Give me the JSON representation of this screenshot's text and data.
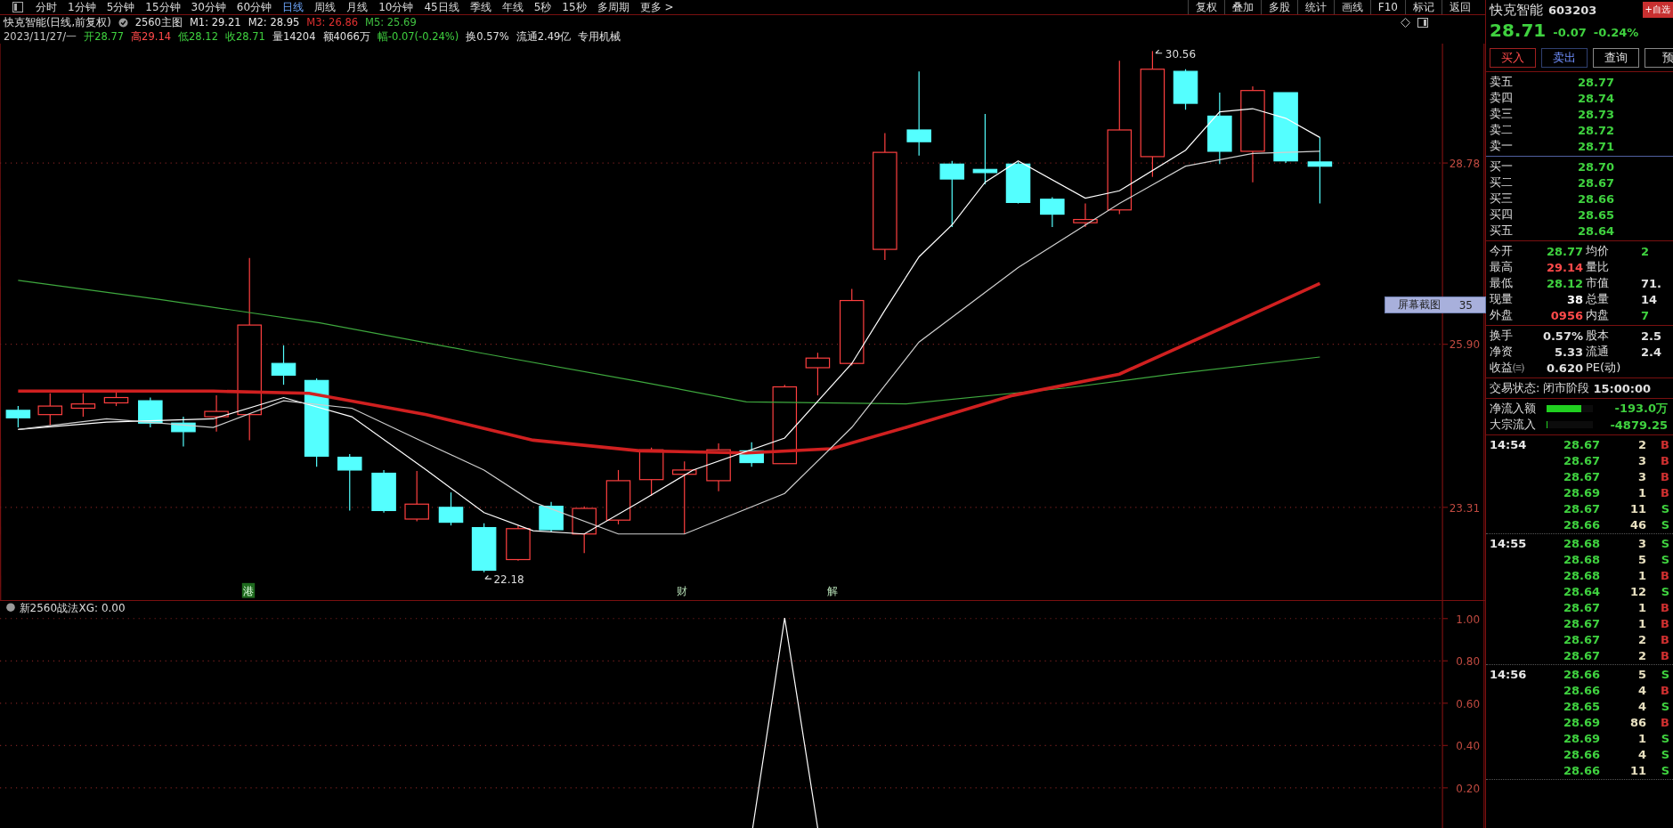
{
  "toolbar": {
    "periods": [
      {
        "label": "分时",
        "selected": false
      },
      {
        "label": "1分钟",
        "selected": false
      },
      {
        "label": "5分钟",
        "selected": false
      },
      {
        "label": "15分钟",
        "selected": false
      },
      {
        "label": "30分钟",
        "selected": false
      },
      {
        "label": "60分钟",
        "selected": false
      },
      {
        "label": "日线",
        "selected": true
      },
      {
        "label": "周线",
        "selected": false
      },
      {
        "label": "月线",
        "selected": false
      },
      {
        "label": "10分钟",
        "selected": false
      },
      {
        "label": "45日线",
        "selected": false
      },
      {
        "label": "季线",
        "selected": false
      },
      {
        "label": "年线",
        "selected": false
      },
      {
        "label": "5秒",
        "selected": false
      },
      {
        "label": "15秒",
        "selected": false
      },
      {
        "label": "多周期",
        "selected": false
      },
      {
        "label": "更多 >",
        "selected": false
      }
    ],
    "actions": [
      "复权",
      "叠加",
      "多股",
      "统计",
      "画线",
      "F10",
      "标记",
      "返回"
    ]
  },
  "chart_header": {
    "title": "快克智能(日线,前复权)",
    "template": "2560主图",
    "averages": [
      {
        "text": "M1: 29.21",
        "color": "#e8e8e8"
      },
      {
        "text": "M2: 28.95",
        "color": "#e8e8e8"
      },
      {
        "text": "M3: 26.86",
        "color": "#e03030"
      },
      {
        "text": "M5: 25.69",
        "color": "#40c040"
      }
    ],
    "quote": [
      {
        "text": "2023/11/27/一",
        "color": "#c8c8c8"
      },
      {
        "text": "开28.77",
        "color": "#3fd13f"
      },
      {
        "text": "高29.14",
        "color": "#ff4a4a"
      },
      {
        "text": "低28.12",
        "color": "#3fd13f"
      },
      {
        "text": "收28.71",
        "color": "#3fd13f"
      },
      {
        "text": "量14204",
        "color": "#e0e0e0"
      },
      {
        "text": "额4066万",
        "color": "#e0e0e0"
      },
      {
        "text": "幅-0.07(-0.24%)",
        "color": "#3fd13f"
      },
      {
        "text": "换0.57%",
        "color": "#e0e0e0"
      },
      {
        "text": "流通2.49亿",
        "color": "#e0e0e0"
      },
      {
        "text": "专用机械",
        "color": "#e0e0e0"
      }
    ]
  },
  "price_chart": {
    "price_axis": [
      "28.78",
      "25.90",
      "23.31"
    ],
    "high_label": "30.56",
    "low_label": "22.18",
    "events": [
      {
        "label": "港",
        "kind": "boxed"
      },
      {
        "label": "财",
        "kind": "plain"
      },
      {
        "label": "解",
        "kind": "plain"
      }
    ]
  },
  "indicator": {
    "name": "新2560战法",
    "reading": "XG: 0.00",
    "axis": [
      "1.00",
      "0.80",
      "0.60",
      "0.40",
      "0.20"
    ]
  },
  "quote_panel": {
    "name": "快克智能",
    "code": "603203",
    "watch_button": "+自选",
    "price": "28.71",
    "change": "-0.07",
    "change_pct": "-0.24%",
    "buttons": [
      {
        "label": "买入",
        "kind": "buy"
      },
      {
        "label": "卖出",
        "kind": "sell"
      },
      {
        "label": "查询",
        "kind": "plain"
      },
      {
        "label": "预",
        "kind": "plain"
      }
    ],
    "asks": [
      {
        "label": "卖五",
        "price": "28.77"
      },
      {
        "label": "卖四",
        "price": "28.74"
      },
      {
        "label": "卖三",
        "price": "28.73"
      },
      {
        "label": "卖二",
        "price": "28.72"
      },
      {
        "label": "卖一",
        "price": "28.71"
      }
    ],
    "bids": [
      {
        "label": "买一",
        "price": "28.70"
      },
      {
        "label": "买二",
        "price": "28.67"
      },
      {
        "label": "买三",
        "price": "28.66"
      },
      {
        "label": "买四",
        "price": "28.65"
      },
      {
        "label": "买五",
        "price": "28.64"
      }
    ],
    "stats": [
      {
        "left": {
          "label": "今开",
          "value": "28.77",
          "color": "#3fd13f"
        },
        "right": {
          "label": "均价",
          "value": "2",
          "color": "#3fd13f"
        }
      },
      {
        "left": {
          "label": "最高",
          "value": "29.14",
          "color": "#ff4a4a"
        },
        "right": {
          "label": "量比"
        }
      },
      {
        "left": {
          "label": "最低",
          "value": "28.12",
          "color": "#3fd13f"
        },
        "right": {
          "label": "市值",
          "value": "71.",
          "color": "#e0e0e0"
        }
      },
      {
        "left": {
          "label": "现量",
          "value": "38",
          "color": "#ffffff"
        },
        "right": {
          "label": "总量",
          "value": "14",
          "color": "#e0e0e0"
        }
      },
      {
        "left": {
          "label": "外盘",
          "value": "0956",
          "color": "#ff4a4a"
        },
        "right": {
          "label": "内盘",
          "value": "7",
          "color": "#3fd13f"
        }
      }
    ],
    "stats2": [
      {
        "left": {
          "label": "换手",
          "value": "0.57%",
          "color": "#e0e0e0"
        },
        "right": {
          "label": "股本",
          "value": "2.5",
          "color": "#e0e0e0"
        }
      },
      {
        "left": {
          "label": "净资",
          "value": "5.33",
          "color": "#e0e0e0"
        },
        "right": {
          "label": "流通",
          "value": "2.4",
          "color": "#e0e0e0"
        }
      },
      {
        "left": {
          "label": "收益㈢",
          "value": "0.620",
          "color": "#e0e0e0"
        },
        "right": {
          "label": "PE(动)"
        }
      }
    ],
    "status_label": "交易状态:",
    "status": "闭市阶段",
    "status_time": "15:00:00",
    "flows": [
      {
        "label": "净流入额",
        "value": "-193.0万",
        "level": 0.75
      },
      {
        "label": "大宗流入",
        "value": "-4879.25",
        "level": 0.02
      }
    ],
    "trades": [
      {
        "time": "14:54",
        "rows": [
          {
            "price": "28.67",
            "volume": "2",
            "side": "B",
            "kind": "buy"
          },
          {
            "price": "28.67",
            "volume": "3",
            "side": "B",
            "kind": "buy"
          },
          {
            "price": "28.67",
            "volume": "3",
            "side": "B",
            "kind": "buy"
          },
          {
            "price": "28.69",
            "volume": "1",
            "side": "B",
            "kind": "buy"
          },
          {
            "price": "28.67",
            "volume": "11",
            "side": "S",
            "kind": "sell"
          },
          {
            "price": "28.66",
            "volume": "46",
            "side": "S",
            "kind": "sell"
          }
        ]
      },
      {
        "time": "14:55",
        "rows": [
          {
            "price": "28.68",
            "volume": "3",
            "side": "S",
            "kind": "sell"
          },
          {
            "price": "28.68",
            "volume": "5",
            "side": "S",
            "kind": "sell"
          },
          {
            "price": "28.68",
            "volume": "1",
            "side": "B",
            "kind": "buy"
          },
          {
            "price": "28.64",
            "volume": "12",
            "side": "S",
            "kind": "sell"
          },
          {
            "price": "28.67",
            "volume": "1",
            "side": "B",
            "kind": "buy"
          },
          {
            "price": "28.67",
            "volume": "1",
            "side": "B",
            "kind": "buy"
          },
          {
            "price": "28.67",
            "volume": "2",
            "side": "B",
            "kind": "buy"
          },
          {
            "price": "28.67",
            "volume": "2",
            "side": "B",
            "kind": "buy"
          }
        ]
      },
      {
        "time": "14:56",
        "rows": [
          {
            "price": "28.66",
            "volume": "5",
            "side": "S",
            "kind": "sell"
          },
          {
            "price": "28.66",
            "volume": "4",
            "side": "B",
            "kind": "buy"
          },
          {
            "price": "28.65",
            "volume": "4",
            "side": "S",
            "kind": "sell"
          },
          {
            "price": "28.69",
            "volume": "86",
            "side": "B",
            "kind": "buy"
          },
          {
            "price": "28.69",
            "volume": "1",
            "side": "S",
            "kind": "sell"
          },
          {
            "price": "28.66",
            "volume": "4",
            "side": "S",
            "kind": "sell"
          },
          {
            "price": "28.66",
            "volume": "11",
            "side": "S",
            "kind": "sell"
          }
        ]
      }
    ]
  },
  "overlay": {
    "label": "屏幕截图",
    "count": "35"
  }
}
